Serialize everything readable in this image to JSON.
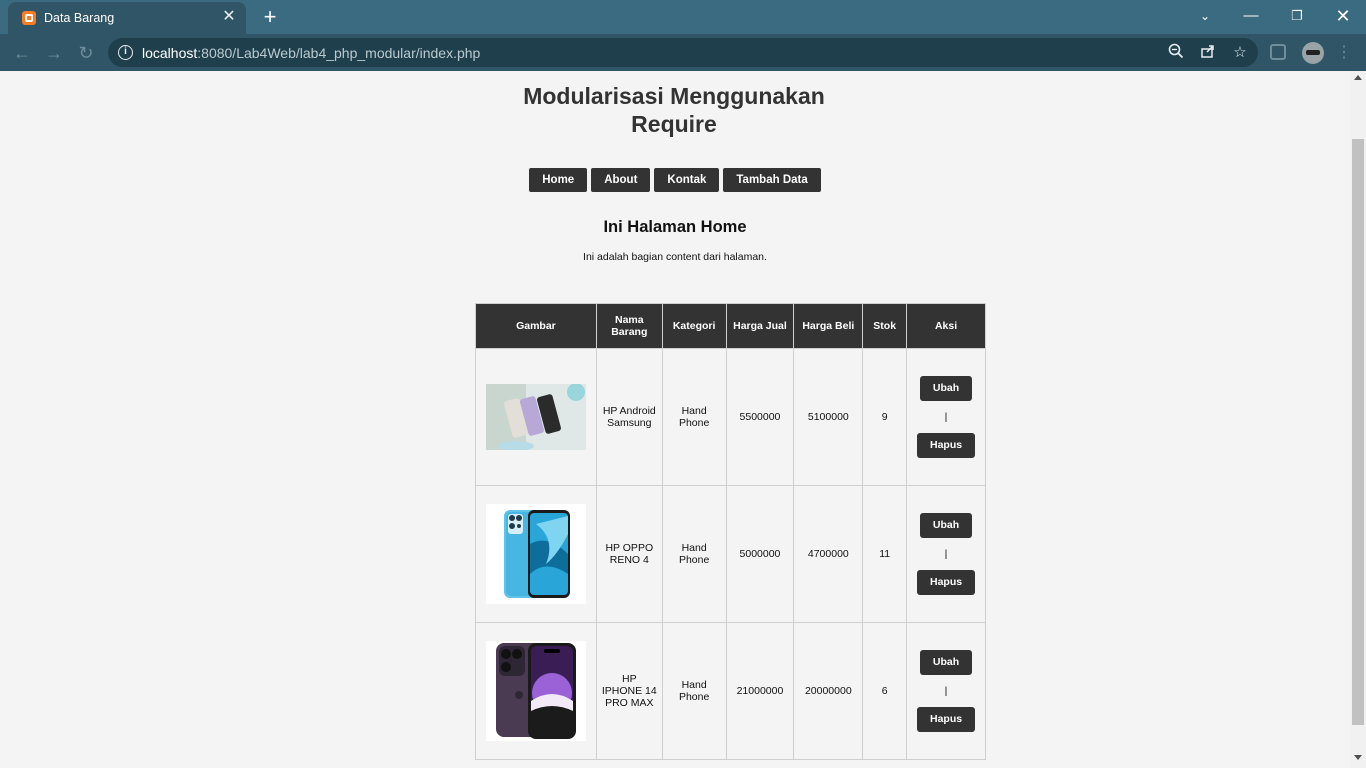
{
  "browser": {
    "tab_title": "Data Barang",
    "new_tab_symbol": "+",
    "url_host": "localhost",
    "url_rest": ":8080/Lab4Web/lab4_php_modular/index.php"
  },
  "page": {
    "title": "Modularisasi Menggunakan Require",
    "nav": [
      {
        "label": "Home"
      },
      {
        "label": "About"
      },
      {
        "label": "Kontak"
      },
      {
        "label": "Tambah Data"
      }
    ],
    "heading": "Ini Halaman Home",
    "content_text": "Ini adalah bagian content dari halaman."
  },
  "table": {
    "headers": [
      "Gambar",
      "Nama Barang",
      "Kategori",
      "Harga Jual",
      "Harga Beli",
      "Stok",
      "Aksi"
    ],
    "action_edit": "Ubah",
    "action_separator": "|",
    "action_delete": "Hapus",
    "rows": [
      {
        "image": "samsung-phones-photo",
        "nama": "HP Android Samsung",
        "kategori": "Hand Phone",
        "harga_jual": "5500000",
        "harga_beli": "5100000",
        "stok": "9"
      },
      {
        "image": "oppo-reno-phone-photo",
        "nama": "HP OPPO RENO 4",
        "kategori": "Hand Phone",
        "harga_jual": "5000000",
        "harga_beli": "4700000",
        "stok": "11"
      },
      {
        "image": "iphone-14-pro-photo",
        "nama": "HP IPHONE 14 PRO MAX",
        "kategori": "Hand Phone",
        "harga_jual": "21000000",
        "harga_beli": "20000000",
        "stok": "6"
      }
    ]
  },
  "colors": {
    "dark": "#333333",
    "tab_bar": "#3a6b80",
    "toolbar": "#2f5566",
    "page_bg": "#f4f4f4"
  }
}
